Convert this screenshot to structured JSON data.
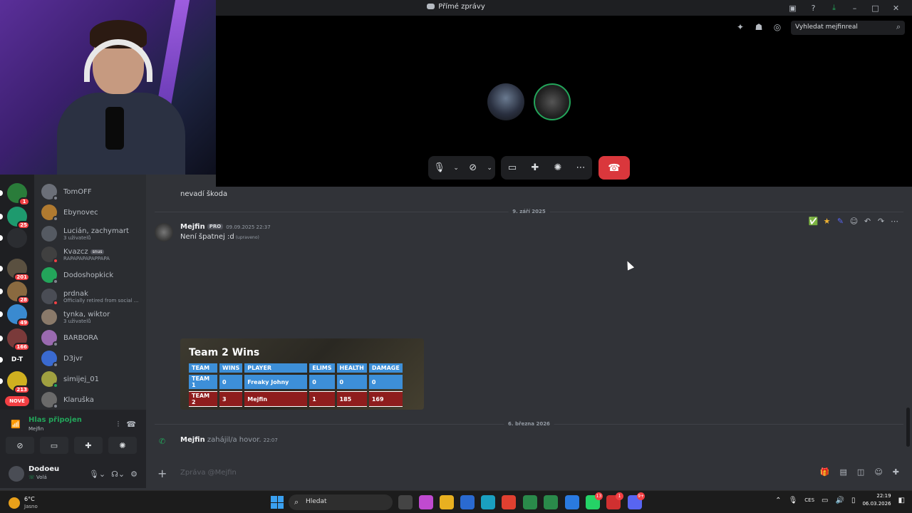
{
  "titlebar": {
    "title": "Přímé zprávy",
    "icons": [
      "inbox-icon",
      "help-icon",
      "download-icon",
      "minimize-icon",
      "maximize-icon",
      "close-icon"
    ]
  },
  "call": {
    "search_placeholder": "Vyhledat mejfinreal",
    "top_icons": [
      "pin-icon",
      "add-friend-icon",
      "inbox-icon"
    ],
    "controls": [
      "microphone-icon",
      "camera-off-icon",
      "screen-share-icon",
      "activities-icon",
      "soundboard-icon",
      "more-icon"
    ],
    "hangup": "hang-up-icon"
  },
  "rail": {
    "servers": [
      {
        "label": "",
        "badge": "1",
        "color": "#2a7c3a"
      },
      {
        "label": "",
        "badge": "25",
        "color": "#1e9a6e"
      },
      {
        "label": "",
        "badge": "",
        "color": "#2b2d31"
      },
      {
        "label": "",
        "badge": "201",
        "color": "#5a5040"
      },
      {
        "label": "",
        "badge": "28",
        "color": "#8a6a40"
      },
      {
        "label": "",
        "badge": "49",
        "color": "#3a8ad0"
      },
      {
        "label": "",
        "badge": "166",
        "color": "#7a3a3a"
      },
      {
        "label": "D-T",
        "badge": "",
        "color": "#1e1f22"
      },
      {
        "label": "",
        "badge": "213",
        "color": "#d0b020"
      }
    ],
    "new_label": "NOVÉ"
  },
  "dms": [
    {
      "name": "TomOFF",
      "sub": "",
      "tag": "",
      "color": "#6b6f78",
      "status": "#80848e"
    },
    {
      "name": "Ebynovec",
      "sub": "",
      "tag": "",
      "color": "#b07a30",
      "status": "#80848e"
    },
    {
      "name": "Lucián, zachymart",
      "sub": "3 uživatelů",
      "tag": "",
      "color": "#555a62",
      "status": ""
    },
    {
      "name": "Kvazcz",
      "sub": "RAPAPAPAPAPPAPA",
      "tag": "snus",
      "color": "#404040",
      "status": "#f23f43"
    },
    {
      "name": "Dodoshopkick",
      "sub": "",
      "tag": "",
      "color": "#23a55a",
      "status": "#80848e"
    },
    {
      "name": "prdnak",
      "sub": "Officially retired from social ...",
      "tag": "",
      "color": "#4a4d55",
      "status": "#f23f43"
    },
    {
      "name": "tynka, wiktor",
      "sub": "3 uživatelů",
      "tag": "",
      "color": "#8a7a6a",
      "status": ""
    },
    {
      "name": "BARBORA",
      "sub": "",
      "tag": "",
      "color": "#9a6ab0",
      "status": "#80848e"
    },
    {
      "name": "D3jvr",
      "sub": "",
      "tag": "",
      "color": "#3a6ad0",
      "status": "#80848e"
    },
    {
      "name": "simijej_01",
      "sub": "",
      "tag": "",
      "color": "#a0a040",
      "status": "#23a55a"
    },
    {
      "name": "Klaruška",
      "sub": "",
      "tag": "",
      "color": "#6a6a6a",
      "status": "#80848e"
    }
  ],
  "voice": {
    "status": "Hlas připojen",
    "channel": "Mejfin"
  },
  "user": {
    "name": "Dodoeu",
    "status": "Volá"
  },
  "chat": {
    "prev_message": "nevadí škoda",
    "date1": "9. září 2025",
    "author": "Mejfin",
    "pro_badge": "PRO",
    "timestamp": "09.09.2025 22:37",
    "message": "Není špatnej :d",
    "edited": "(upraveno)",
    "date2": "6. března 2026",
    "call_author": "Mejfin",
    "call_text": "zahájil/a hovor.",
    "call_time": "22:07",
    "composer_placeholder": "Zpráva @Mejfin"
  },
  "scoreboard": {
    "title": "Team 2 Wins",
    "headers": [
      "TEAM",
      "WINS",
      "PLAYER",
      "ELIMS",
      "HEALTH",
      "DAMAGE"
    ],
    "rows": [
      [
        "TEAM 1",
        "0",
        "Freaky Johny",
        "0",
        "0",
        "0"
      ],
      [
        "TEAM 2",
        "3",
        "Mejfin",
        "1",
        "185",
        "169"
      ]
    ]
  },
  "taskbar": {
    "temp": "6°C",
    "condition": "Jasno",
    "search": "Hledat",
    "lang": "CES",
    "time": "22:19",
    "date": "06.03.2026",
    "apps": [
      {
        "color": "#444",
        "badge": ""
      },
      {
        "color": "#c04ad0",
        "badge": ""
      },
      {
        "color": "#e8b020",
        "badge": ""
      },
      {
        "color": "#2a6ad0",
        "badge": ""
      },
      {
        "color": "#1aa0c0",
        "badge": ""
      },
      {
        "color": "#e04030",
        "badge": ""
      },
      {
        "color": "#2a8a4a",
        "badge": ""
      },
      {
        "color": "#2a8a4a",
        "badge": ""
      },
      {
        "color": "#2a7ae0",
        "badge": ""
      },
      {
        "color": "#25d366",
        "badge": "13"
      },
      {
        "color": "#d03030",
        "badge": "1"
      },
      {
        "color": "#5865f2",
        "badge": "9+"
      }
    ]
  }
}
